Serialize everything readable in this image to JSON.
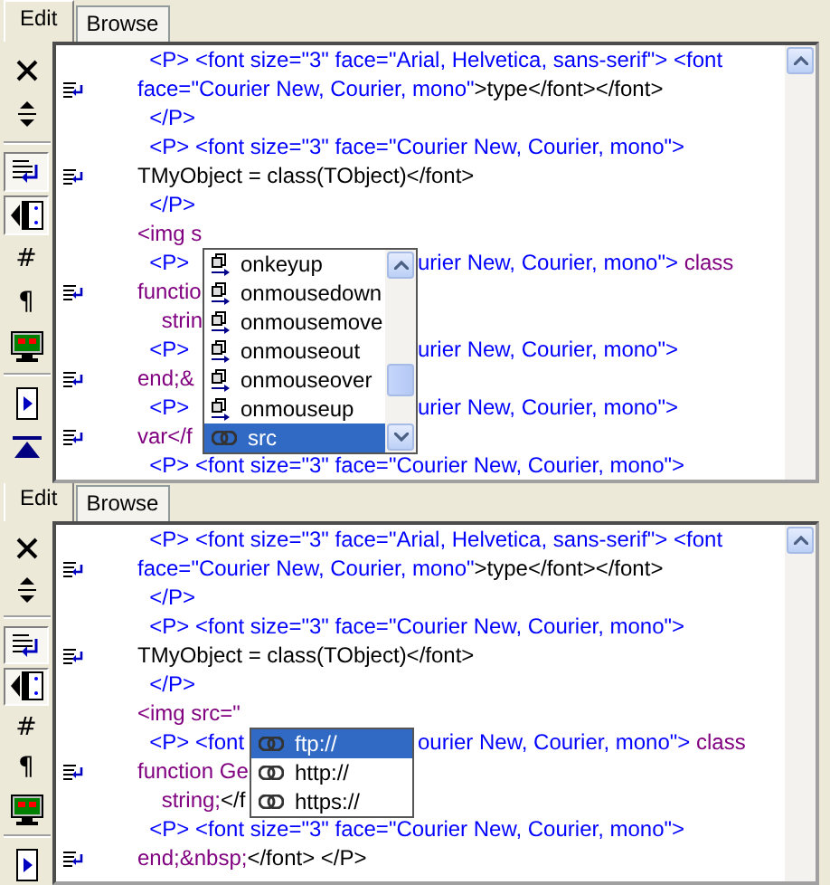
{
  "panes": [
    {
      "tabs": [
        {
          "label": "Edit",
          "selected": true
        },
        {
          "label": "Browse",
          "selected": false
        }
      ],
      "toolbar": [
        {
          "kind": "close",
          "pressed": false
        },
        {
          "kind": "split",
          "pressed": false
        },
        {
          "kind": "separator"
        },
        {
          "kind": "wrap",
          "pressed": true
        },
        {
          "kind": "gutter",
          "pressed": true
        },
        {
          "kind": "glyph",
          "glyph": "#",
          "pressed": false
        },
        {
          "kind": "glyph",
          "glyph": "¶",
          "pressed": false
        },
        {
          "kind": "monitor",
          "pressed": false
        },
        {
          "kind": "separator"
        },
        {
          "kind": "play",
          "pressed": false
        },
        {
          "kind": "top",
          "pressed": false
        }
      ],
      "lines": [
        {
          "marker": false,
          "head": [
            {
              "kind": "tag",
              "text": "  <P> <font size=\"3\" face=\"Arial, Helvetica, sans-serif\"> <font"
            }
          ]
        },
        {
          "marker": true,
          "head": [
            {
              "kind": "tag",
              "text": "face=\"Courier New, Courier, mono\""
            },
            {
              "kind": "text",
              "text": ">type</font></font>"
            }
          ]
        },
        {
          "marker": false,
          "head": [
            {
              "kind": "tag",
              "text": "  </P>"
            }
          ]
        },
        {
          "marker": false,
          "head": [
            {
              "kind": "tag",
              "text": "  <P> <font size=\"3\" face=\"Courier New, Courier, mono\">"
            }
          ]
        },
        {
          "marker": true,
          "head": [
            {
              "kind": "text",
              "text": "TMyObject = class(TObject)</font>"
            }
          ]
        },
        {
          "marker": false,
          "head": [
            {
              "kind": "tag",
              "text": "  </P>"
            }
          ]
        },
        {
          "marker": false,
          "head": [
            {
              "kind": "script",
              "text": "<img s"
            }
          ]
        },
        {
          "marker": false,
          "head": [
            {
              "kind": "tag",
              "text": "  <P>"
            }
          ],
          "tail": [
            {
              "kind": "tag",
              "text": "urier New, Courier, mono\">"
            },
            {
              "kind": "script",
              "text": " class"
            }
          ]
        },
        {
          "marker": true,
          "head": [
            {
              "kind": "script",
              "text": "functio"
            }
          ]
        },
        {
          "marker": false,
          "head": [
            {
              "kind": "script",
              "text": "    strin"
            }
          ]
        },
        {
          "marker": false,
          "head": [
            {
              "kind": "tag",
              "text": "  <P>"
            }
          ],
          "tail": [
            {
              "kind": "tag",
              "text": "urier New, Courier, mono\">"
            }
          ]
        },
        {
          "marker": true,
          "head": [
            {
              "kind": "script",
              "text": "end;&"
            }
          ]
        },
        {
          "marker": false,
          "head": [
            {
              "kind": "tag",
              "text": "  <P>"
            }
          ],
          "tail": [
            {
              "kind": "tag",
              "text": "urier New, Courier, mono\">"
            }
          ]
        },
        {
          "marker": true,
          "head": [
            {
              "kind": "script",
              "text": "var</f"
            }
          ]
        },
        {
          "marker": false,
          "head": [
            {
              "kind": "tag",
              "text": "  <P> <font size=\"3\" face=\"Courier New, Courier, mono\">"
            }
          ]
        }
      ],
      "completion": {
        "items": [
          {
            "kind": "event",
            "label": "onkeyup",
            "selected": false
          },
          {
            "kind": "event",
            "label": "onmousedown",
            "selected": false
          },
          {
            "kind": "event",
            "label": "onmousemove",
            "selected": false
          },
          {
            "kind": "event",
            "label": "onmouseout",
            "selected": false
          },
          {
            "kind": "event",
            "label": "onmouseover",
            "selected": false
          },
          {
            "kind": "event",
            "label": "onmouseup",
            "selected": false
          },
          {
            "kind": "attribute",
            "label": "src",
            "selected": true
          }
        ]
      }
    },
    {
      "tabs": [
        {
          "label": "Edit",
          "selected": true
        },
        {
          "label": "Browse",
          "selected": false
        }
      ],
      "toolbar": [
        {
          "kind": "close",
          "pressed": false
        },
        {
          "kind": "split",
          "pressed": false
        },
        {
          "kind": "separator"
        },
        {
          "kind": "wrap",
          "pressed": true
        },
        {
          "kind": "gutter",
          "pressed": true
        },
        {
          "kind": "glyph",
          "glyph": "#",
          "pressed": false
        },
        {
          "kind": "glyph",
          "glyph": "¶",
          "pressed": false
        },
        {
          "kind": "monitor",
          "pressed": false
        },
        {
          "kind": "separator"
        },
        {
          "kind": "play",
          "pressed": false
        }
      ],
      "lines": [
        {
          "marker": false,
          "head": [
            {
              "kind": "tag",
              "text": "  <P> <font size=\"3\" face=\"Arial, Helvetica, sans-serif\"> <font"
            }
          ]
        },
        {
          "marker": true,
          "head": [
            {
              "kind": "tag",
              "text": "face=\"Courier New, Courier, mono\""
            },
            {
              "kind": "text",
              "text": ">type</font></font>"
            }
          ]
        },
        {
          "marker": false,
          "head": [
            {
              "kind": "tag",
              "text": "  </P>"
            }
          ]
        },
        {
          "marker": false,
          "head": [
            {
              "kind": "tag",
              "text": "  <P> <font size=\"3\" face=\"Courier New, Courier, mono\">"
            }
          ]
        },
        {
          "marker": true,
          "head": [
            {
              "kind": "text",
              "text": "TMyObject = class(TObject)</font>"
            }
          ]
        },
        {
          "marker": false,
          "head": [
            {
              "kind": "tag",
              "text": "  </P>"
            }
          ]
        },
        {
          "marker": false,
          "head": [
            {
              "kind": "script",
              "text": "<img src=\""
            }
          ]
        },
        {
          "marker": false,
          "head": [
            {
              "kind": "tag",
              "text": "  <P> <font"
            }
          ],
          "tail": [
            {
              "kind": "tag",
              "text": "ourier New, Courier, mono\">"
            },
            {
              "kind": "script",
              "text": " class"
            }
          ]
        },
        {
          "marker": true,
          "head": [
            {
              "kind": "script",
              "text": "function Ge"
            }
          ]
        },
        {
          "marker": false,
          "head": [
            {
              "kind": "script",
              "text": "    string;"
            },
            {
              "kind": "text",
              "text": "</f"
            }
          ]
        },
        {
          "marker": false,
          "head": [
            {
              "kind": "tag",
              "text": "  <P> <font size=\"3\" face=\"Courier New, Courier, mono\">"
            }
          ]
        },
        {
          "marker": true,
          "head": [
            {
              "kind": "script",
              "text": "end;&nbsp;"
            },
            {
              "kind": "text",
              "text": "</font> </P>"
            }
          ]
        }
      ],
      "completion": {
        "items": [
          {
            "kind": "attribute",
            "label": "ftp://",
            "selected": true
          },
          {
            "kind": "attribute",
            "label": "http://",
            "selected": false
          },
          {
            "kind": "attribute",
            "label": "https://",
            "selected": false
          }
        ]
      }
    }
  ]
}
